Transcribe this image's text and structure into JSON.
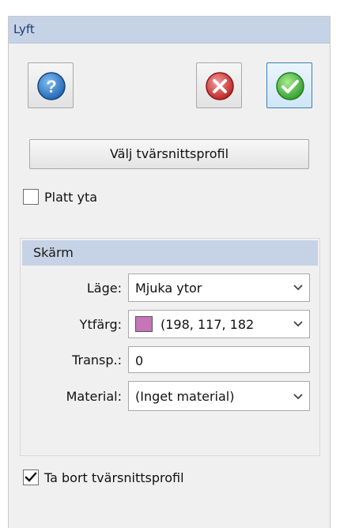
{
  "panel": {
    "title": "Lyft"
  },
  "toolbar": {
    "help_icon": "help-icon",
    "cancel_icon": "cancel-icon",
    "ok_icon": "ok-icon"
  },
  "profile_button_label": "Välj tvärsnittsprofil",
  "flat_surface": {
    "label": "Platt yta",
    "checked": false
  },
  "display_group": {
    "title": "Skärm",
    "mode": {
      "label": "Läge:",
      "value": "Mjuka ytor"
    },
    "surface_color": {
      "label": "Ytfärg:",
      "value": "(198, 117, 182",
      "swatch": "#c675b6"
    },
    "transparency": {
      "label": "Transp.:",
      "value": "0"
    },
    "material": {
      "label": "Material:",
      "value": "(Inget material)"
    }
  },
  "remove_profile": {
    "label": "Ta bort tvärsnittsprofil",
    "checked": true
  },
  "colors": {
    "header_bg": "#c6d3e6",
    "title_text": "#1e3d78",
    "help_blue": "#1d6fc4",
    "cancel_red": "#d93a3a",
    "ok_green": "#3fb83a"
  }
}
